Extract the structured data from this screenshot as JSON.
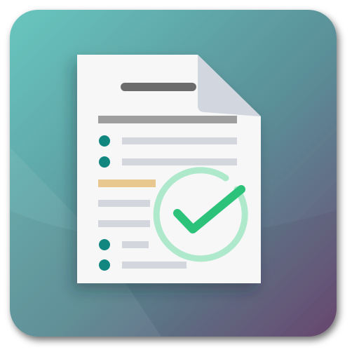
{
  "app_icon": {
    "name": "document-checklist-icon",
    "colors": {
      "gradient_top_left": "#68c6bf",
      "gradient_mid": "#5a8f98",
      "gradient_bottom_right": "#6d4a73",
      "paper": "#f7f7f8",
      "fold": "#d9dde3",
      "title_bar": "#6c6c6c",
      "header_line": "#9e9e9e",
      "list_line": "#d3d6dc",
      "highlight_line": "#e9c88f",
      "bullet": "#11877f",
      "check_ring": "#aee9cc",
      "checkmark": "#2cc27a"
    }
  },
  "document": {
    "bulleted_rows": 4,
    "plain_rows": 2,
    "highlighted_rows": 1
  },
  "status": {
    "checked": true
  }
}
